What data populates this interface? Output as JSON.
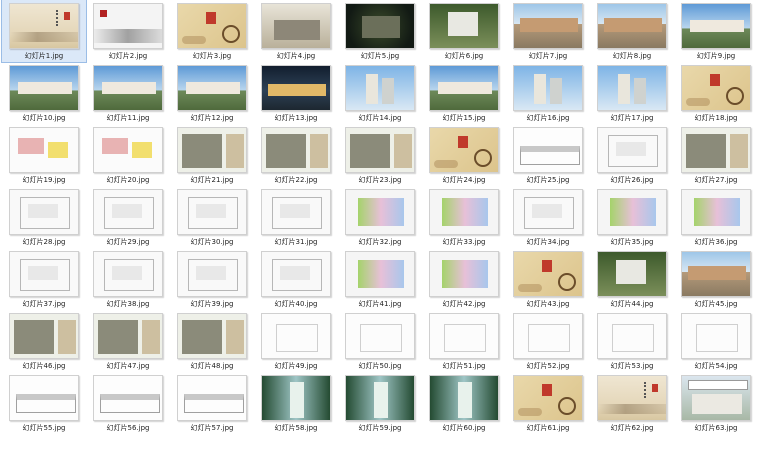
{
  "files": [
    {
      "name": "幻灯片1.jpg",
      "thumb": "scroll",
      "selected": true
    },
    {
      "name": "幻灯片2.jpg",
      "thumb": "ink"
    },
    {
      "name": "幻灯片3.jpg",
      "thumb": "paper"
    },
    {
      "name": "幻灯片4.jpg",
      "thumb": "aerial"
    },
    {
      "name": "幻灯片5.jpg",
      "thumb": "dark"
    },
    {
      "name": "幻灯片6.jpg",
      "thumb": "aerial2"
    },
    {
      "name": "幻灯片7.jpg",
      "thumb": "street"
    },
    {
      "name": "幻灯片8.jpg",
      "thumb": "street"
    },
    {
      "name": "幻灯片9.jpg",
      "thumb": "sky"
    },
    {
      "name": "幻灯片10.jpg",
      "thumb": "sky"
    },
    {
      "name": "幻灯片11.jpg",
      "thumb": "sky"
    },
    {
      "name": "幻灯片12.jpg",
      "thumb": "sky"
    },
    {
      "name": "幻灯片13.jpg",
      "thumb": "night"
    },
    {
      "name": "幻灯片14.jpg",
      "thumb": "tower"
    },
    {
      "name": "幻灯片15.jpg",
      "thumb": "sky"
    },
    {
      "name": "幻灯片16.jpg",
      "thumb": "tower"
    },
    {
      "name": "幻灯片17.jpg",
      "thumb": "tower"
    },
    {
      "name": "幻灯片18.jpg",
      "thumb": "paper"
    },
    {
      "name": "幻灯片19.jpg",
      "thumb": "map"
    },
    {
      "name": "幻灯片20.jpg",
      "thumb": "map"
    },
    {
      "name": "幻灯片21.jpg",
      "thumb": "photo"
    },
    {
      "name": "幻灯片22.jpg",
      "thumb": "photo"
    },
    {
      "name": "幻灯片23.jpg",
      "thumb": "photo"
    },
    {
      "name": "幻灯片24.jpg",
      "thumb": "paper"
    },
    {
      "name": "幻灯片25.jpg",
      "thumb": "elev"
    },
    {
      "name": "幻灯片26.jpg",
      "thumb": "plan"
    },
    {
      "name": "幻灯片27.jpg",
      "thumb": "photo"
    },
    {
      "name": "幻灯片28.jpg",
      "thumb": "plan"
    },
    {
      "name": "幻灯片29.jpg",
      "thumb": "plan"
    },
    {
      "name": "幻灯片30.jpg",
      "thumb": "plan"
    },
    {
      "name": "幻灯片31.jpg",
      "thumb": "plan"
    },
    {
      "name": "幻灯片32.jpg",
      "thumb": "color"
    },
    {
      "name": "幻灯片33.jpg",
      "thumb": "color"
    },
    {
      "name": "幻灯片34.jpg",
      "thumb": "plan"
    },
    {
      "name": "幻灯片35.jpg",
      "thumb": "color"
    },
    {
      "name": "幻灯片36.jpg",
      "thumb": "color"
    },
    {
      "name": "幻灯片37.jpg",
      "thumb": "plan"
    },
    {
      "name": "幻灯片38.jpg",
      "thumb": "plan"
    },
    {
      "name": "幻灯片39.jpg",
      "thumb": "plan"
    },
    {
      "name": "幻灯片40.jpg",
      "thumb": "plan"
    },
    {
      "name": "幻灯片41.jpg",
      "thumb": "color"
    },
    {
      "name": "幻灯片42.jpg",
      "thumb": "color"
    },
    {
      "name": "幻灯片43.jpg",
      "thumb": "paper"
    },
    {
      "name": "幻灯片44.jpg",
      "thumb": "aerial2"
    },
    {
      "name": "幻灯片45.jpg",
      "thumb": "street"
    },
    {
      "name": "幻灯片46.jpg",
      "thumb": "photo"
    },
    {
      "name": "幻灯片47.jpg",
      "thumb": "photo"
    },
    {
      "name": "幻灯片48.jpg",
      "thumb": "photo"
    },
    {
      "name": "幻灯片49.jpg",
      "thumb": "whitedoc"
    },
    {
      "name": "幻灯片50.jpg",
      "thumb": "whitedoc"
    },
    {
      "name": "幻灯片51.jpg",
      "thumb": "whitedoc"
    },
    {
      "name": "幻灯片52.jpg",
      "thumb": "whitedoc"
    },
    {
      "name": "幻灯片53.jpg",
      "thumb": "whitedoc"
    },
    {
      "name": "幻灯片54.jpg",
      "thumb": "whitedoc"
    },
    {
      "name": "幻灯片55.jpg",
      "thumb": "elev"
    },
    {
      "name": "幻灯片56.jpg",
      "thumb": "elev"
    },
    {
      "name": "幻灯片57.jpg",
      "thumb": "elev"
    },
    {
      "name": "幻灯片58.jpg",
      "thumb": "corridor"
    },
    {
      "name": "幻灯片59.jpg",
      "thumb": "corridor"
    },
    {
      "name": "幻灯片60.jpg",
      "thumb": "corridor"
    },
    {
      "name": "幻灯片61.jpg",
      "thumb": "paper"
    },
    {
      "name": "幻灯片62.jpg",
      "thumb": "scroll"
    },
    {
      "name": "幻灯片63.jpg",
      "thumb": "city"
    }
  ]
}
